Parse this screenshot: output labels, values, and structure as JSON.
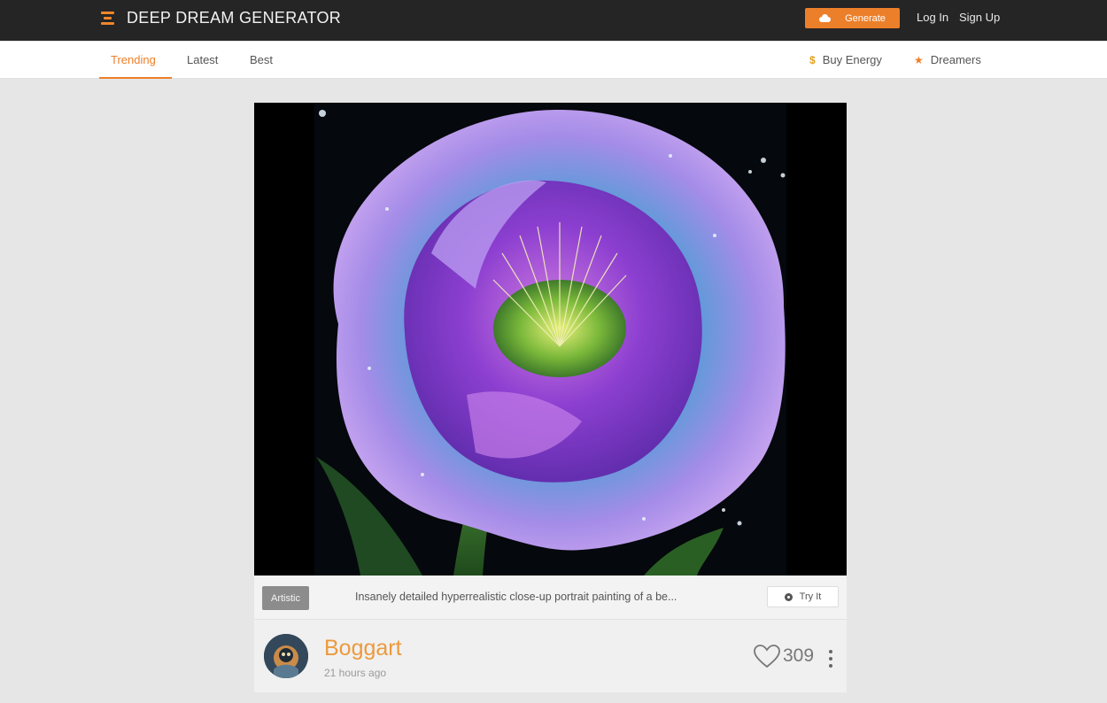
{
  "header": {
    "logo_text": "DEEP DREAM GENERATOR",
    "generate_label": "Generate",
    "login_label": "Log In",
    "signup_label": "Sign Up"
  },
  "nav": {
    "tabs": [
      {
        "label": "Trending",
        "active": true
      },
      {
        "label": "Latest",
        "active": false
      },
      {
        "label": "Best",
        "active": false
      }
    ],
    "buy_energy_label": "Buy Energy",
    "dreamers_label": "Dreamers"
  },
  "post": {
    "tag": "Artistic",
    "prompt": "Insanely detailed hyperrealistic close-up portrait painting of a be...",
    "try_label": "Try It",
    "author": "Boggart",
    "time": "21 hours ago",
    "likes": "309"
  },
  "colors": {
    "accent": "#ec7f2a",
    "topbar": "#252525",
    "page_bg": "#e6e6e6"
  }
}
